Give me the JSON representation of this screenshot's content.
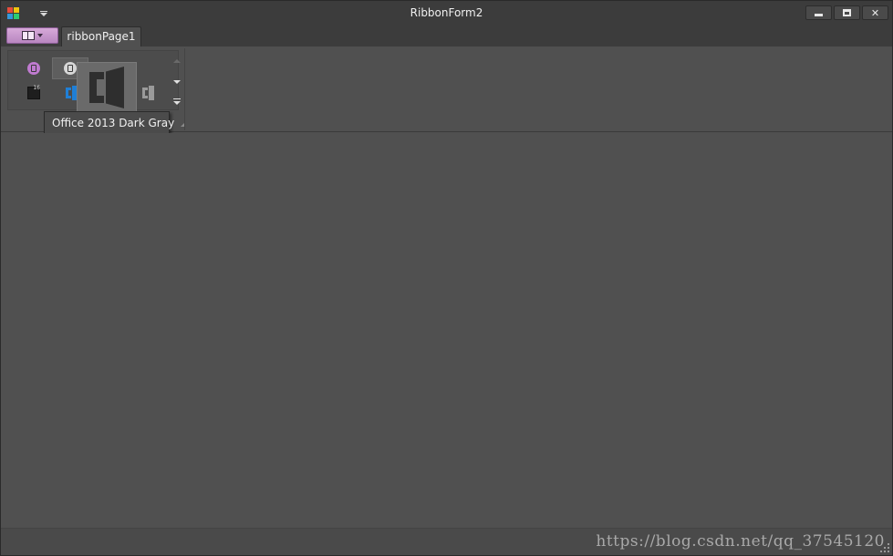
{
  "window": {
    "title": "RibbonForm2"
  },
  "tabs": [
    {
      "label": "ribbonPage1"
    }
  ],
  "gallery": {
    "items": [
      {
        "icon": "office-2016-colorful-skin-icon",
        "color": "#c07bd0"
      },
      {
        "icon": "office-2016-dark-skin-icon",
        "color": "#d7d7d7"
      },
      {
        "icon": "visual-studio-2016-dark-skin-icon",
        "color": "#1e1e1e"
      },
      {
        "icon": "office-2013-blue-skin-icon",
        "color": "#1f7fd6"
      },
      {
        "icon": "office-2013-light-gray-skin-icon",
        "color": "#9a9a9a"
      }
    ],
    "hovered_preview_icon": "office-2013-dark-gray-skin-icon"
  },
  "tooltip": {
    "text": "Office 2013 Dark Gray"
  },
  "status": {
    "watermark": "https://blog.csdn.net/qq_37545120"
  },
  "colors": {
    "app_button": "#c99ad0",
    "accent_blue": "#1f7fd6",
    "background": "#505050"
  }
}
